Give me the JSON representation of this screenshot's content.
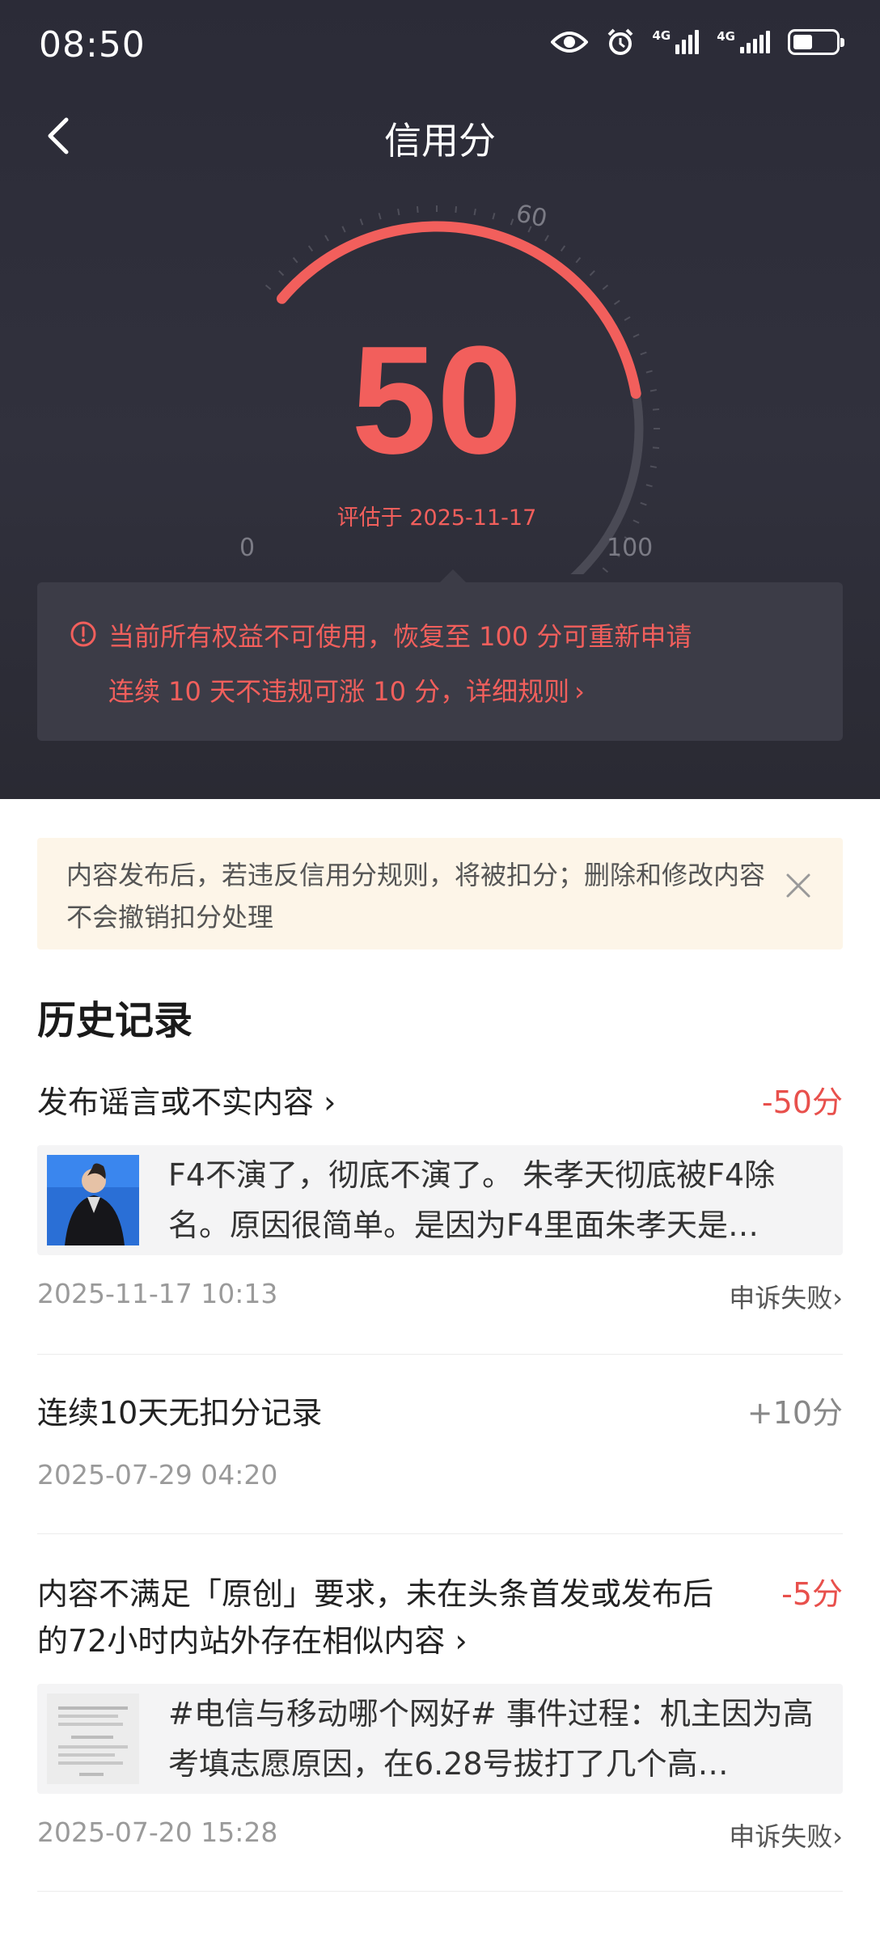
{
  "status_bar": {
    "time": "08:50",
    "icons": [
      "eye-icon",
      "alarm-icon",
      "signal-4g-icon",
      "signal-4g-icon",
      "battery-icon"
    ],
    "network_1": "4G",
    "network_2": "4G",
    "battery_level": 0.45
  },
  "header": {
    "title": "信用分"
  },
  "gauge": {
    "score": "50",
    "min_label": "0",
    "mark_label": "60",
    "max_label": "100",
    "eval_date": "评估于 2025-11-17",
    "value": 50,
    "max": 100,
    "colors": {
      "active": "#f25f5c",
      "track": "#4a4a55"
    }
  },
  "warning": {
    "line1": "当前所有权益不可使用，恢复至 100 分可重新申请",
    "line2": "连续 10 天不违规可涨 10 分，详细规则",
    "chevron": "›"
  },
  "tip": {
    "text": "内容发布后，若违反信用分规则，将被扣分；删除和修改内容不会撤销扣分处理"
  },
  "history": {
    "title": "历史记录",
    "records": [
      {
        "title": "发布谣言或不实内容",
        "chevron": "›",
        "score": "-50分",
        "snippet": "F4不演了，彻底不演了。 朱孝天彻底被F4除名。原因很简单。是因为F4里面朱孝天是…",
        "time": "2025-11-17 10:13",
        "appeal": "申诉失败",
        "appeal_chevron": "›"
      },
      {
        "title": "连续10天无扣分记录",
        "score": "+10分",
        "time": "2025-07-29 04:20"
      },
      {
        "title": "内容不满足「原创」要求，未在头条首发或发布后的72小时内站外存在相似内容",
        "chevron": "›",
        "score": "-5分",
        "snippet": "#电信与移动哪个网好# 事件过程：机主因为高考填志愿原因，在6.28号拔打了几个高…",
        "time": "2025-07-20 15:28",
        "appeal": "申诉失败",
        "appeal_chevron": "›"
      }
    ]
  }
}
